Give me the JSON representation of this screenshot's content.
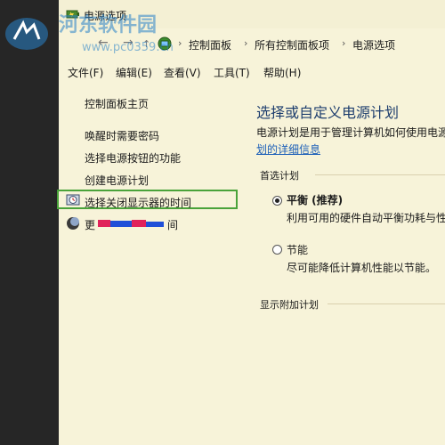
{
  "window": {
    "title": "电源选项"
  },
  "nav": {
    "breadcrumbs": [
      "控制面板",
      "所有控制面板项",
      "电源选项"
    ]
  },
  "menu": [
    "文件(F)",
    "编辑(E)",
    "查看(V)",
    "工具(T)",
    "帮助(H)"
  ],
  "sidebar": {
    "home": "控制面板主页",
    "links": [
      "唤醒时需要密码",
      "选择电源按钮的功能",
      "创建电源计划",
      "选择关闭显示器的时间",
      "更",
      "间"
    ]
  },
  "main": {
    "title": "选择或自定义电源计划",
    "description_line1": "电源计划是用于管理计算机如何使用电源",
    "description_link": "划的详细信息",
    "preferred_heading": "首选计划",
    "plans": [
      {
        "name": "平衡 (推荐)",
        "description": "利用可用的硬件自动平衡功耗与性",
        "selected": true
      },
      {
        "name": "节能",
        "description": "尽可能降低计算机性能以节能。",
        "selected": false
      }
    ],
    "additional_heading": "显示附加计划"
  },
  "watermark": {
    "title": "河东软件园",
    "url": "www.pc0359.cn"
  },
  "colors": {
    "window_bg": "#f7f3d9",
    "highlight": "#4aa33a",
    "link": "#1c5fb8",
    "title": "#1e3e6e"
  }
}
